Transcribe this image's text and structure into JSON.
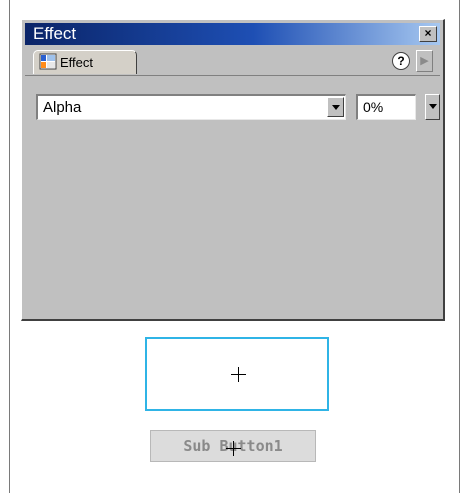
{
  "window": {
    "title": "Effect",
    "close_glyph": "×"
  },
  "tab": {
    "label": "Effect",
    "icon": "effect-panel-icon"
  },
  "toolbar": {
    "help_glyph": "?",
    "menu_glyph": "▶"
  },
  "effect": {
    "type_value": "Alpha",
    "amount_value": "0%"
  },
  "stage": {
    "sub_button_label": "Sub Button1"
  },
  "colors": {
    "title_gradient_start": "#0a2468",
    "title_gradient_end": "#a7c8f0",
    "panel_bg": "#c0c0c0",
    "selection_outline": "#2fb4e6"
  }
}
